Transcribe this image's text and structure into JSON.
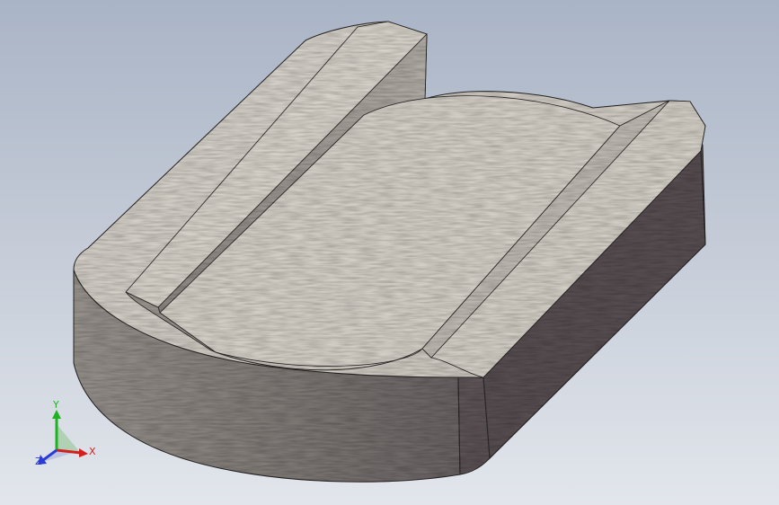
{
  "viewport": {
    "background_top": "#a9b4c6",
    "background_bottom": "#e2e6ec"
  },
  "model": {
    "top_face_color": "#d6d2c9",
    "side_face_color": "#8b8582",
    "dark_side_color": "#5e5558"
  },
  "triad": {
    "x_label": "X",
    "y_label": "Y",
    "z_label": "Z",
    "x_color": "#d41f1f",
    "y_color": "#1fb321",
    "z_color": "#2b3bd6"
  }
}
